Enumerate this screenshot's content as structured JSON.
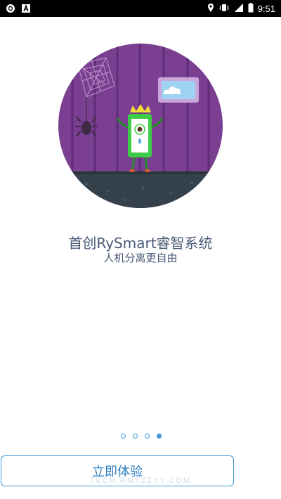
{
  "status_bar": {
    "time": "9:51",
    "left_icons": [
      "sync-icon",
      "font-a-icon"
    ],
    "right_icons": [
      "location-icon",
      "vibrate-icon",
      "signal-icon",
      "battery-icon"
    ]
  },
  "intro": {
    "title": "首创RySmart睿智系统",
    "subtitle": "人机分离更自由"
  },
  "pager": {
    "total": 4,
    "active_index": 3
  },
  "cta": {
    "label": "立即体验"
  },
  "watermark": "TECH.RMTZZYY.COM",
  "colors": {
    "accent": "#3e98d8",
    "text": "#4a5a78",
    "hero_bg": "#7b3f92",
    "hero_floor": "#34414a",
    "phone_green": "#3ccc46",
    "crown_yellow": "#f2dd37"
  }
}
